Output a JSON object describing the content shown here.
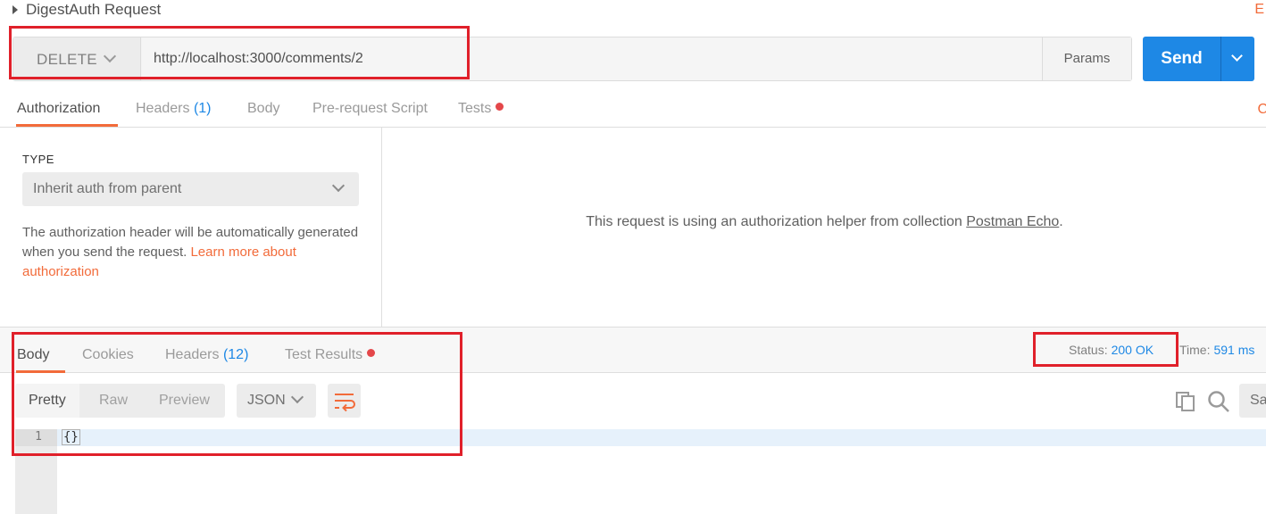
{
  "request": {
    "title": "DigestAuth Request",
    "edit_text": "E"
  },
  "url_bar": {
    "method": "DELETE",
    "url": "http://localhost:3000/comments/2",
    "params_label": "Params",
    "send_label": "Send"
  },
  "request_tabs": {
    "authorization": "Authorization",
    "headers": "Headers",
    "headers_count": "(1)",
    "body": "Body",
    "pre_request": "Pre-request Script",
    "tests": "Tests",
    "edge_text": "C"
  },
  "auth": {
    "type_label": "TYPE",
    "type_value": "Inherit auth from parent",
    "description": "The authorization header will be automatically generated when you send the request. ",
    "learn_more": "Learn more about authorization",
    "helper_text": "This request is using an authorization helper from collection ",
    "collection_name": "Postman Echo",
    "helper_period": "."
  },
  "response": {
    "tabs": {
      "body": "Body",
      "cookies": "Cookies",
      "headers": "Headers",
      "headers_count": "(12)",
      "test_results": "Test Results"
    },
    "status_label": "Status:",
    "status_value": "200 OK",
    "time_label": "Time:",
    "time_value": "591 ms",
    "views": {
      "pretty": "Pretty",
      "raw": "Raw",
      "preview": "Preview"
    },
    "format": "JSON",
    "save_label": "Sa",
    "editor": {
      "line_number": "1",
      "content": "{}"
    }
  },
  "colors": {
    "accent_orange": "#f26b3a",
    "link_blue": "#1e88e5",
    "annotation_red": "#e0202a",
    "dot_red": "#e4474a"
  }
}
